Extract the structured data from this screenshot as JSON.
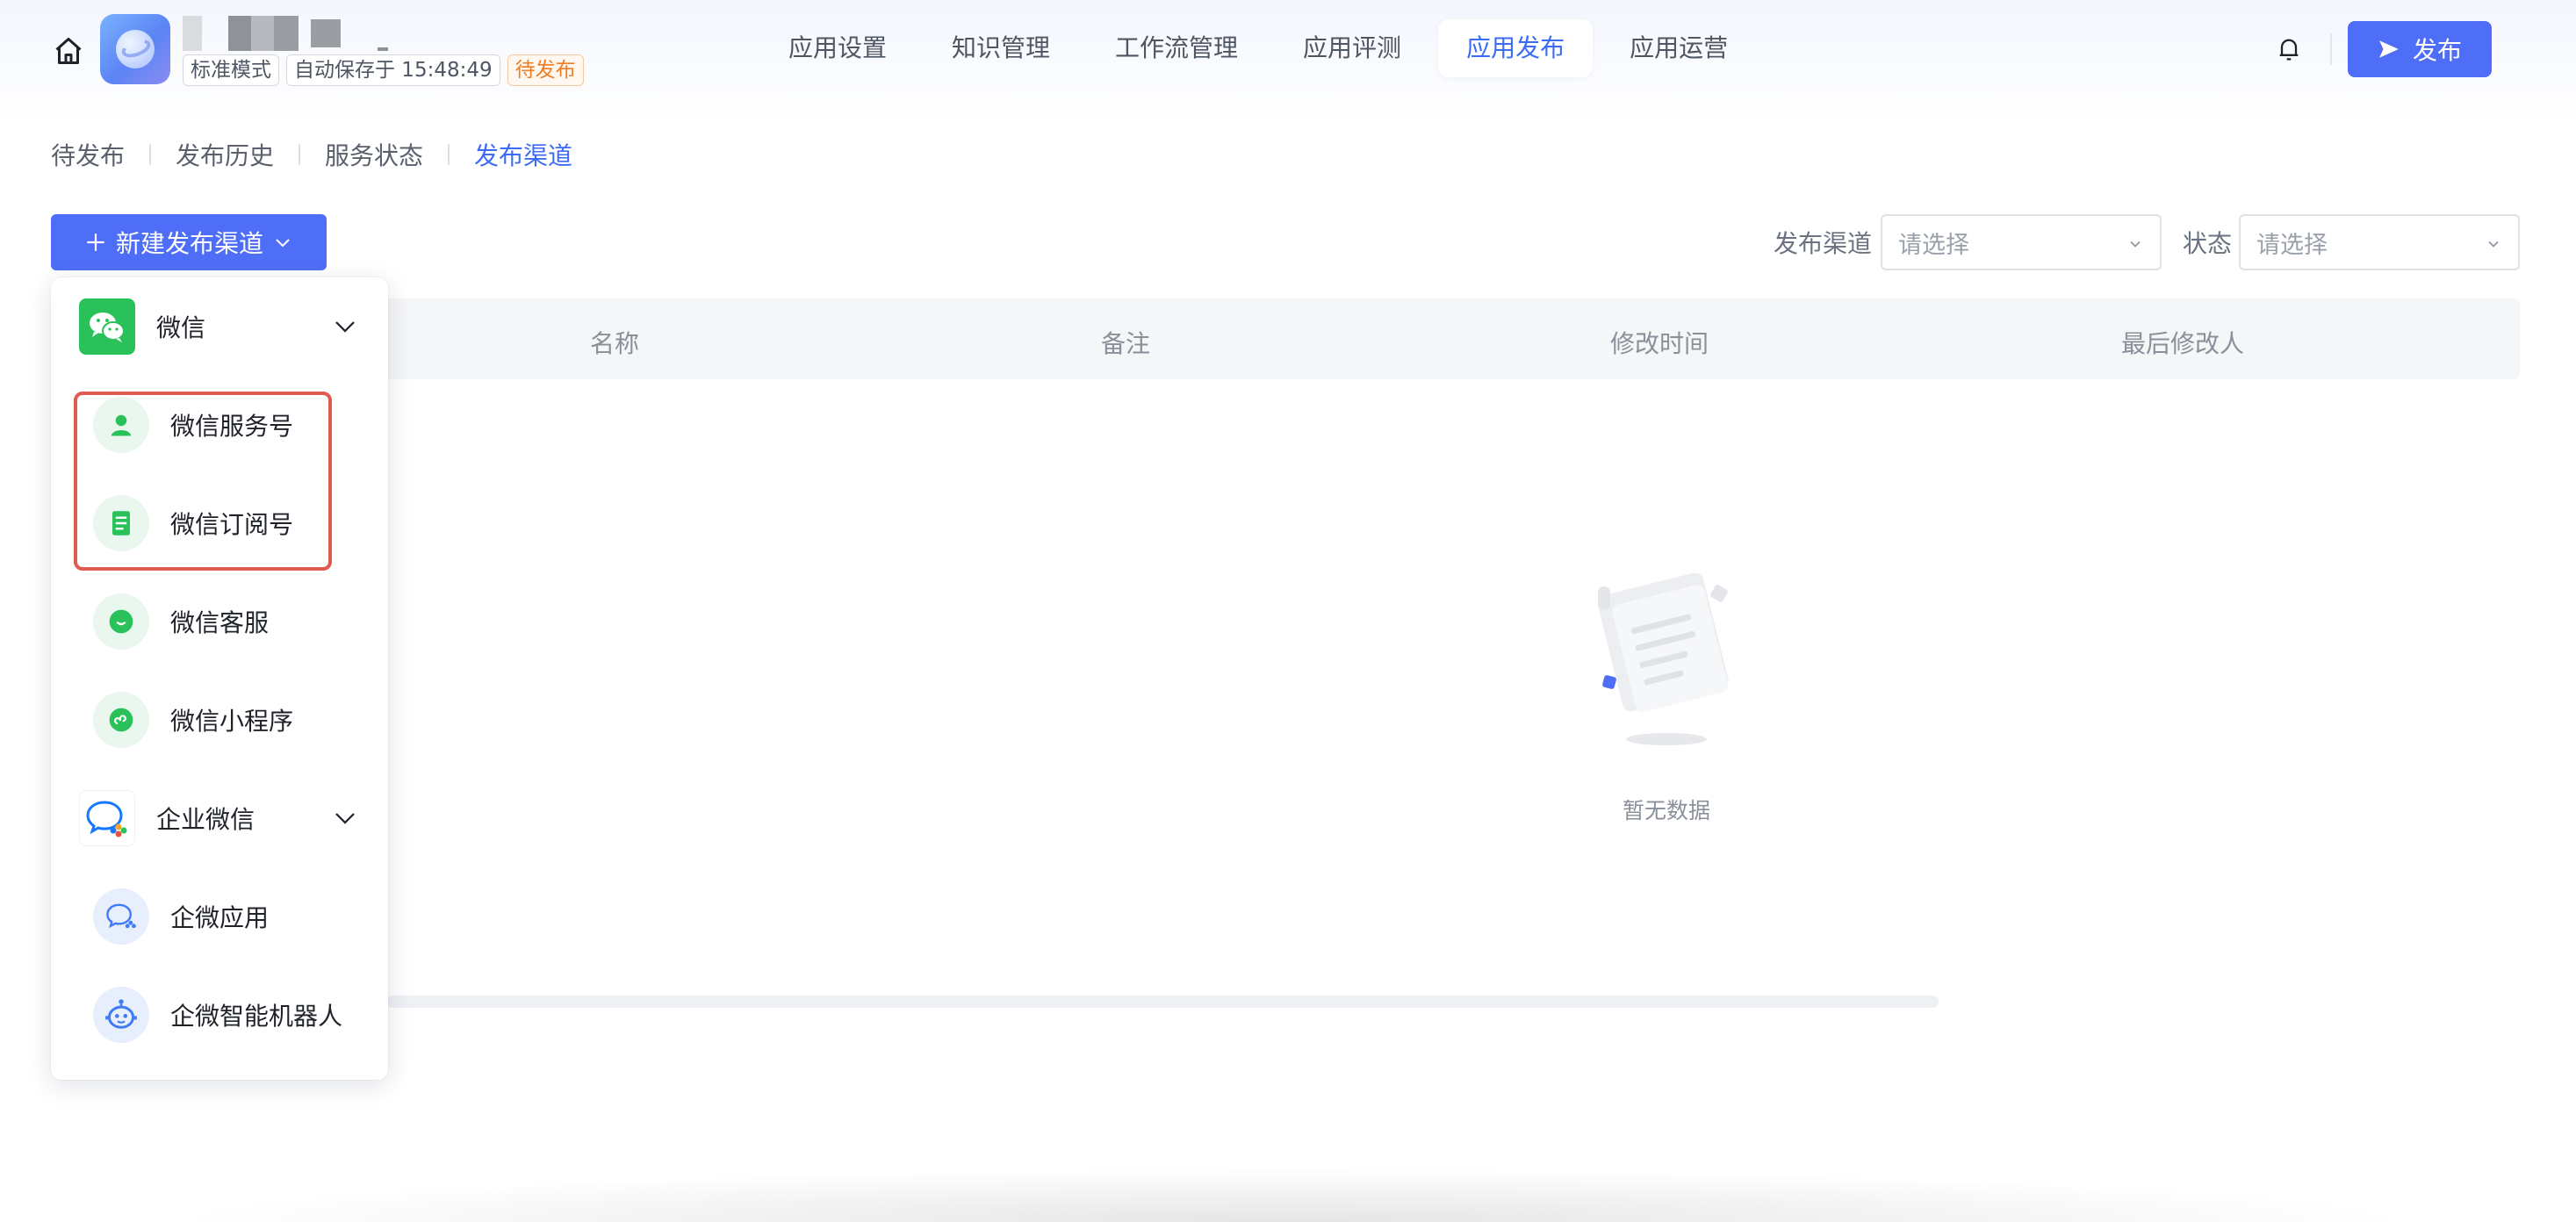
{
  "header": {
    "status_tags": [
      "标准模式",
      "自动保存于 15:48:49",
      "待发布"
    ],
    "main_tabs": [
      {
        "label": "应用设置"
      },
      {
        "label": "知识管理"
      },
      {
        "label": "工作流管理"
      },
      {
        "label": "应用评测"
      },
      {
        "label": "应用发布",
        "active": true
      },
      {
        "label": "应用运营"
      }
    ],
    "publish_label": "发布"
  },
  "sub_tabs": [
    {
      "label": "待发布"
    },
    {
      "label": "发布历史"
    },
    {
      "label": "服务状态"
    },
    {
      "label": "发布渠道",
      "active": true
    }
  ],
  "toolbar": {
    "new_channel_label": "新建发布渠道",
    "filter_channel_label": "发布渠道",
    "filter_channel_placeholder": "请选择",
    "filter_status_label": "状态",
    "filter_status_placeholder": "请选择"
  },
  "table": {
    "columns": [
      "名称",
      "备注",
      "修改时间",
      "最后修改人"
    ],
    "empty_text": "暂无数据"
  },
  "dropdown": {
    "groups": [
      {
        "label": "微信",
        "icon": "wechat-icon",
        "items": [
          {
            "label": "微信服务号",
            "icon": "service-account-icon"
          },
          {
            "label": "微信订阅号",
            "icon": "subscription-account-icon"
          },
          {
            "label": "微信客服",
            "icon": "customer-service-icon"
          },
          {
            "label": "微信小程序",
            "icon": "mini-program-icon"
          }
        ]
      },
      {
        "label": "企业微信",
        "icon": "wecom-icon",
        "items": [
          {
            "label": "企微应用",
            "icon": "wecom-app-icon"
          },
          {
            "label": "企微智能机器人",
            "icon": "wecom-robot-icon"
          }
        ]
      }
    ]
  },
  "colors": {
    "primary": "#4f6ef7",
    "active_text": "#3c6cf6",
    "wechat_green": "#2ac15a",
    "highlight_red": "#e15c50",
    "pending_orange": "#ef7d24"
  }
}
